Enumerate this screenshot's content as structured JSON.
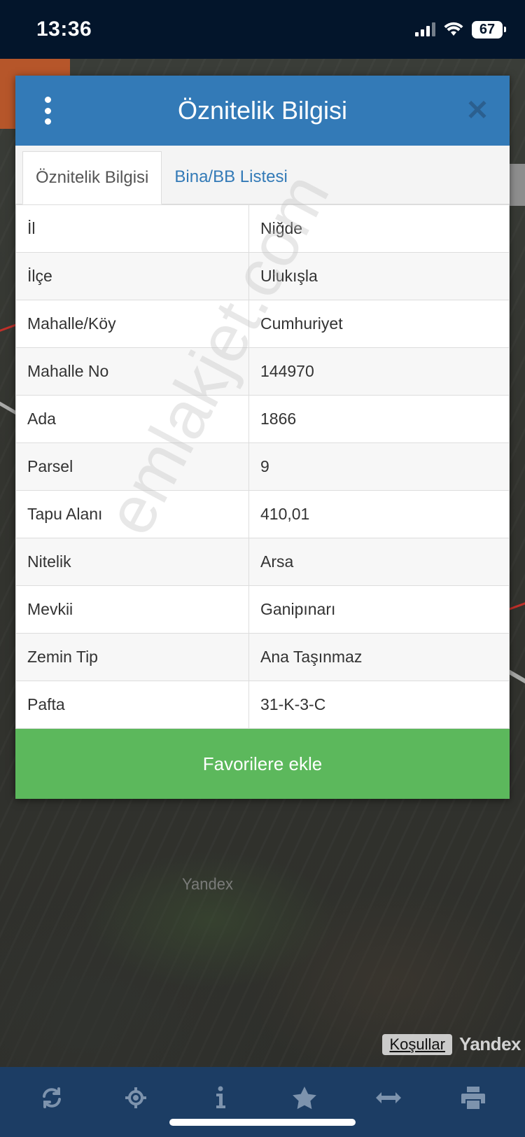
{
  "status_bar": {
    "time": "13:36",
    "battery": "67"
  },
  "dialog": {
    "title": "Öznitelik Bilgisi",
    "tabs": [
      {
        "label": "Öznitelik Bilgisi",
        "active": true
      },
      {
        "label": "Bina/BB Listesi",
        "active": false
      }
    ],
    "rows": [
      {
        "key": "İl",
        "value": "Niğde"
      },
      {
        "key": "İlçe",
        "value": "Ulukışla"
      },
      {
        "key": "Mahalle/Köy",
        "value": "Cumhuriyet"
      },
      {
        "key": "Mahalle No",
        "value": "144970"
      },
      {
        "key": "Ada",
        "value": "1866"
      },
      {
        "key": "Parsel",
        "value": "9"
      },
      {
        "key": "Tapu Alanı",
        "value": "410,01"
      },
      {
        "key": "Nitelik",
        "value": "Arsa"
      },
      {
        "key": "Mevkii",
        "value": "Ganipınarı"
      },
      {
        "key": "Zemin Tip",
        "value": "Ana Taşınmaz"
      },
      {
        "key": "Pafta",
        "value": "31-K-3-C"
      }
    ],
    "favorite_button": "Favorilere ekle"
  },
  "watermark": "emlakjet.com",
  "map": {
    "yandex_mark": "Yandex",
    "conditions_link": "Koşullar",
    "logo": "Yandex"
  },
  "colors": {
    "header": "#337ab7",
    "favorite": "#5cb85c",
    "toolbar": "#1c3d64",
    "status_bar": "#03152b"
  },
  "toolbar_icons": [
    "refresh-icon",
    "locate-icon",
    "info-icon",
    "star-icon",
    "measure-icon",
    "print-icon"
  ]
}
